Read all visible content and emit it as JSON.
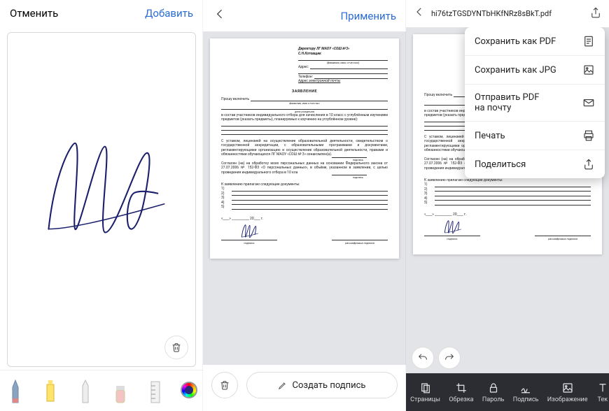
{
  "panel1": {
    "cancel": "Отменить",
    "add": "Добавить"
  },
  "panel2": {
    "apply": "Применить",
    "create_signature": "Создать подпись"
  },
  "panel3": {
    "filename": "hi76tzTGSDYNTbHKfNRz8sBkT.pdf",
    "menu": {
      "save_pdf": "Сохранить как PDF",
      "save_jpg": "Сохранить как JPG",
      "send_pdf_line1": "Отправить PDF",
      "send_pdf_line2": "на почту",
      "print": "Печать",
      "share": "Поделиться"
    },
    "bottom": {
      "pages": "Страницы",
      "crop": "Обрезка",
      "password": "Пароль",
      "sign": "Подпись",
      "image": "Изображение",
      "text": "Тек"
    }
  },
  "doc": {
    "header_to": "Директору   ЛГ   МАОУ   «СОШ   №3»",
    "header_name": "С.Н.Котовщик",
    "header_fio_label": "(фамилия, имя, отчество)",
    "addr_label": "Адрес:",
    "tel_label": "Телефон:",
    "email_label": "Адрес электронной почты",
    "title": "ЗАЯВЛЕНИЕ",
    "line_include": "Прошу включить",
    "fio_sub": "фамилия, имя отчество",
    "dob_sub": "дата рождения",
    "body1": "в состав участников индивидуального отбора для зачисления в 10 класс с углублённым изучением предметов (указать предметы), планируемых к изучению на углублённом уровне):",
    "body2": "С уставом, лицензией на осуществление образовательной деятельности, свидетельством о государственной аккредитации, с образовательными программами и документами, регламентирующими организацию и осуществление образовательной деятельности, правами и обязанностями обучающихся ЛГ МАОУ «СОШ № 3» ознакомлен(а).",
    "sign_small": "подпись",
    "body3": "Согласен (на) на обработку моих персональных данных на основании Федерального закона от 27.07.2006 № 152-ФЗ «О персональных данных», в объёме, указанном в заявлении, с целью проведения индивидуального отбора в 10 кла",
    "attach": "К заявлению прилагаю следующие документы:",
    "n1": "1)",
    "n2": "2)",
    "n3": "3)",
    "n4": "4)",
    "n5": "5)",
    "date_row": "«____» ___________ 20____ г.",
    "sig_label_left": "подпись",
    "sig_label_right": "расшифровка подписи"
  }
}
